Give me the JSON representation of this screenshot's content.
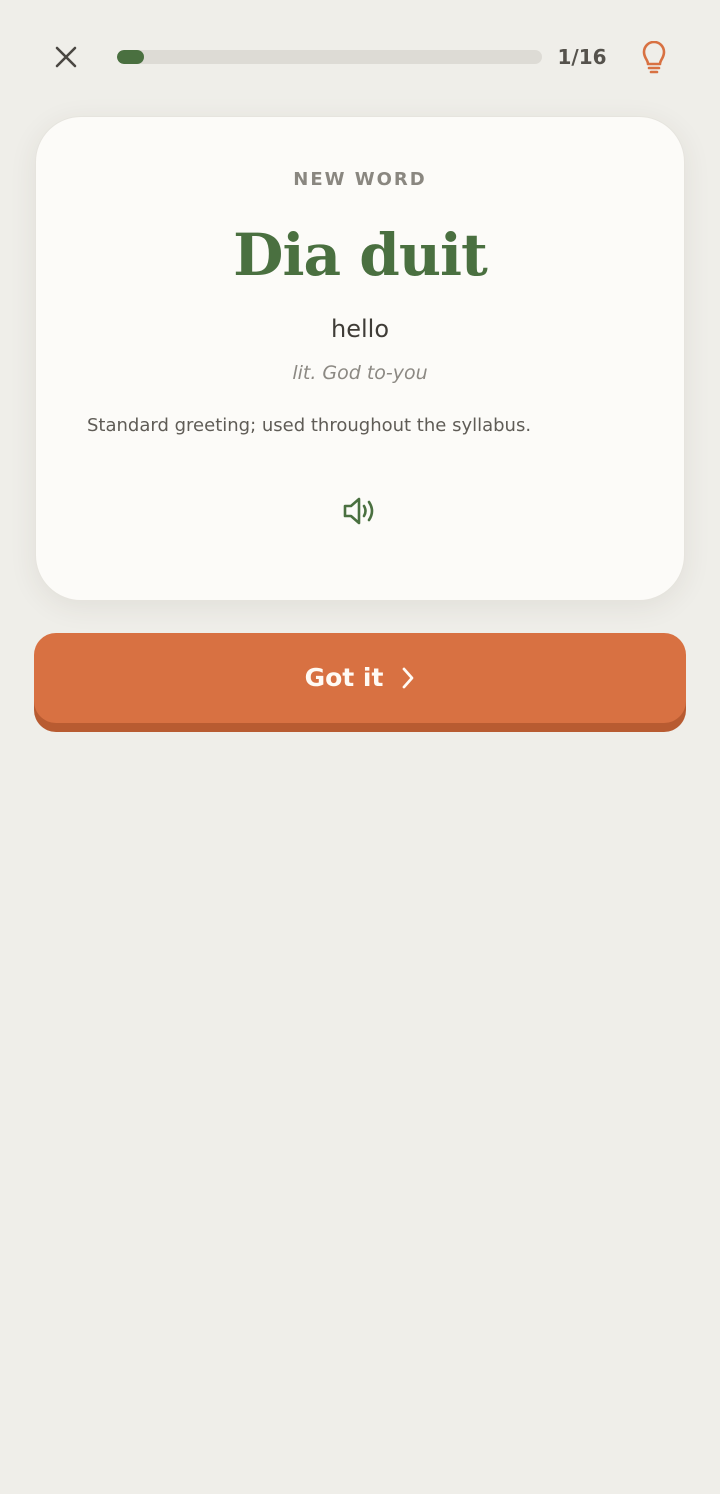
{
  "header": {
    "close_icon": "close-icon",
    "progress": {
      "current": 1,
      "total": 16,
      "fraction": 0.0625
    },
    "counter_text": "1/16",
    "hint_icon": "lightbulb-icon"
  },
  "card": {
    "eyebrow": "NEW WORD",
    "word": "Dia duit",
    "translation": "hello",
    "literal": "lit. God to-you",
    "note": "Standard greeting; used throughout the syllabus.",
    "audio_icon": "speaker-icon"
  },
  "action": {
    "label": "Got it",
    "icon": "chevron-right-icon"
  },
  "colors": {
    "background": "#efeee9",
    "accent_green": "#4a7040",
    "accent_orange": "#d87142",
    "button_shadow": "#b85b31",
    "card": "#fcfbf8"
  }
}
